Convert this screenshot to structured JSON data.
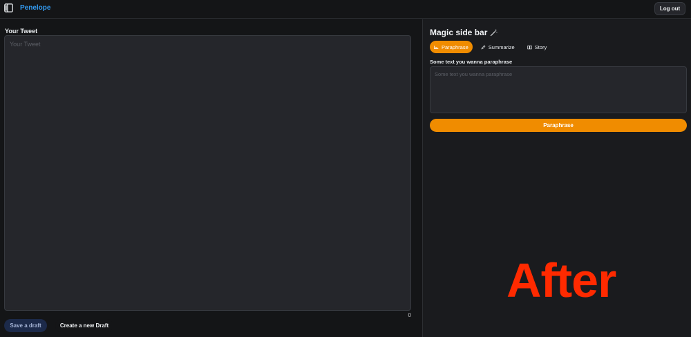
{
  "header": {
    "brand": "Penelope",
    "logout_label": "Log out",
    "logo_icon": "sidebar-layout-icon",
    "brand_color": "#339af0"
  },
  "editor": {
    "label": "Your Tweet",
    "placeholder": "Your Tweet",
    "value": "",
    "char_count": "0",
    "save_label": "Save a draft",
    "new_draft_label": "Create a new Draft"
  },
  "sidebar": {
    "title": "Magic side bar",
    "title_icon": "magic-wand-icon",
    "tabs": [
      {
        "label": "Paraphrase",
        "icon": "paraphrase-icon",
        "active": true
      },
      {
        "label": "Summarize",
        "icon": "pencil-icon",
        "active": false
      },
      {
        "label": "Story",
        "icon": "book-icon",
        "active": false
      }
    ],
    "input_label": "Some text you wanna paraphrase",
    "input_placeholder": "Some text you wanna paraphrase",
    "input_value": "",
    "submit_label": "Paraphrase",
    "accent_color": "#f08c00"
  },
  "overlay": {
    "text": "After",
    "color": "#ff2a00"
  }
}
